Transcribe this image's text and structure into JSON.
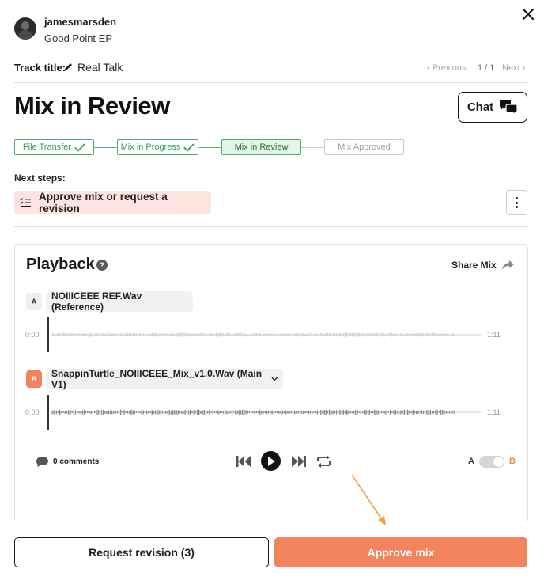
{
  "header": {
    "username": "jamesmarsden",
    "project": "Good Point EP",
    "track_label": "Track title:",
    "track_title": "Real Talk",
    "nav": {
      "previous": "Previous",
      "count": "1 / 1",
      "next": "Next"
    }
  },
  "page_title": "Mix in Review",
  "chat_label": "Chat",
  "stepper": [
    {
      "label": "File Transfer",
      "status": "done"
    },
    {
      "label": "Mix in Progress",
      "status": "done"
    },
    {
      "label": "Mix in Review",
      "status": "current"
    },
    {
      "label": "Mix Approved",
      "status": "todo"
    }
  ],
  "next_steps": {
    "label": "Next steps:",
    "item": "Approve mix or request a revision"
  },
  "playback": {
    "title": "Playback",
    "help": "?",
    "share_label": "Share Mix",
    "tracks": [
      {
        "badge": "A",
        "name": "NOIIICEEE REF.Wav (Reference)",
        "start": "0:00",
        "end": "1:11"
      },
      {
        "badge": "B",
        "name": "SnappinTurtle_NOIIICEEE_Mix_v1.0.Wav (Main V1)",
        "start": "0:00",
        "end": "1:11"
      }
    ],
    "comments": "0 comments",
    "ab_a": "A",
    "ab_b": "B",
    "ab_selected": "B"
  },
  "footer": {
    "revision_label": "Request revision (3)",
    "approve_label": "Approve mix"
  },
  "colors": {
    "accent": "#f2845d",
    "step_green": "#4caf6b",
    "next_step_bg": "#fde4df",
    "annotation_arrow": "#f0a23c"
  }
}
